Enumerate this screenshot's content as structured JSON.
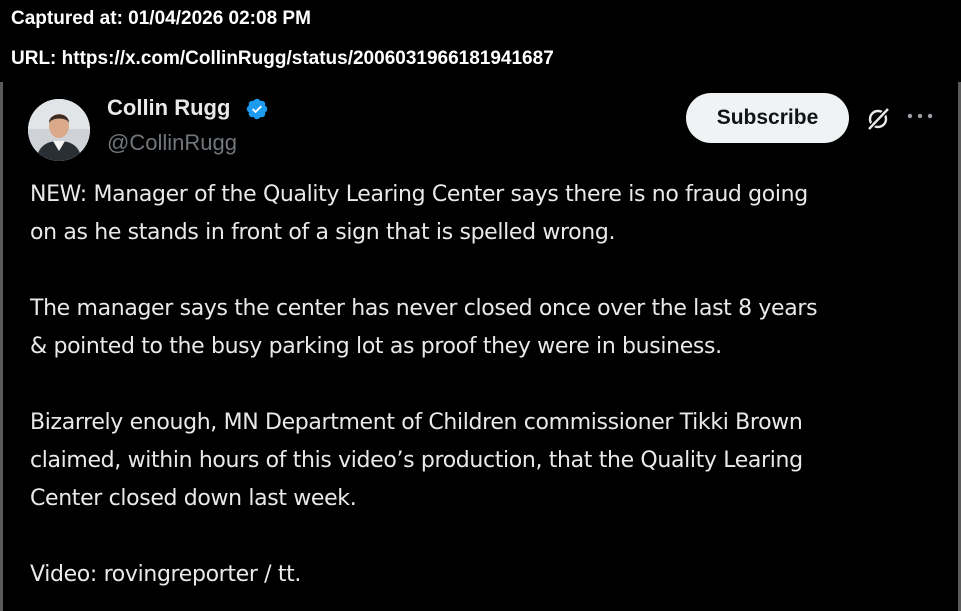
{
  "capture": {
    "captured_at": "Captured at: 01/04/2026 02:08 PM",
    "url": "URL: https://x.com/CollinRugg/status/2006031966181941687"
  },
  "tweet": {
    "author": {
      "name": "Collin Rugg",
      "handle": "@CollinRugg",
      "verified": true
    },
    "subscribe_label": "Subscribe",
    "paragraphs": [
      "NEW: Manager of the Quality Learing Center says there is no fraud going\non as he stands in front of a sign that is spelled wrong.",
      "The manager says the center has never closed once over the last 8 years\n& pointed to the busy parking lot as proof they were in business.",
      "Bizarrely enough, MN Department of Children commissioner Tikki Brown\nclaimed, within hours of this video’s production, that the Quality Learing\nCenter closed down last week.",
      "Video: rovingreporter / tt."
    ]
  },
  "colors": {
    "background": "#000000",
    "text": "#e7e9ea",
    "secondary_text": "#71767b",
    "verified_badge": "#1d9bf0",
    "subscribe_bg": "#eff3f4"
  },
  "icons": {
    "verified": "verified-badge-icon",
    "grok": "grok-icon",
    "more": "more-options-icon"
  }
}
